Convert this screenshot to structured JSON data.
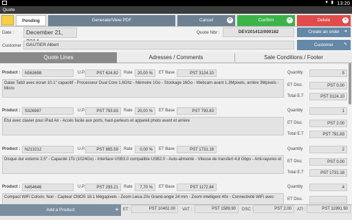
{
  "statusbar": {
    "time": "13:20",
    "signal_icons": "▼ ▮"
  },
  "app": {
    "title": "Quote"
  },
  "header": {
    "status_tab": "Pending",
    "generate_label": "Generate/View PDF",
    "cancel_label": "Cancel",
    "confirm_label": "Confirm",
    "delete_label": "Delete",
    "date_label": "Date :",
    "date_value": "December 21, 2014",
    "quote_nbr_label": "Quote Nbr :",
    "quote_nbr_value": "DEV201412/000182",
    "create_order_label": "Create an order",
    "customer_label": "Customer :",
    "customer_value": "GAUTIER Albert",
    "customer_button": "Customer"
  },
  "tabs": [
    {
      "label": "Quote Lines"
    },
    {
      "label": "Adresses / Comments"
    },
    {
      "label": "Sale Conditions / Footer"
    }
  ],
  "field_labels": {
    "product": "Product :",
    "up": "U.P.",
    "rate": "Rate",
    "et_base": "ET Base",
    "quantity": "Quantity",
    "et_disc": "ET Disc.",
    "total_et": "Total E.T"
  },
  "lines": [
    {
      "product": "N563698",
      "up": "PST 624.82",
      "rate": "20,00 %",
      "et_base": "PST 3124.10",
      "quantity": "5",
      "et_disc": "PST 0.00",
      "total_et": "PST 3124.10",
      "description": "Galax Tab3 avec écran 10.1\" capacitif - Processeur Dual Core 1,6Ghz - Mémoire 1Go - Stockage 16Go - Webcam avant 1,3Mpixels, arrière 3Mpixels - Micro"
    },
    {
      "product": "S326987",
      "up": "PST 793.83",
      "rate": "20,00 %",
      "et_base": "PST 793.83",
      "quantity": "1",
      "et_disc": "PST 2.00",
      "total_et": "PST 791.83",
      "description": "Etui avec clavier pour iPad Air - Accès facile aux ports, haut-parleurs et appareil photo avant et arrière"
    },
    {
      "product": "N213212",
      "up": "PST 865.59",
      "rate": "0,00 %",
      "et_base": "PST 1731.18",
      "quantity": "2",
      "et_disc": "PST 0.00",
      "total_et": "PST 1731.18",
      "description": "Disque dur externe 2.5\" - Capacité 1To (1024Go) - Interface USB3.0 compatible USB2.0 - Auto-alimenté - Vitesse de transfert 4.8 Gbps - Anti-rayures et"
    },
    {
      "product": "N454646",
      "up": "PST 293.21",
      "rate": "7,70 %",
      "et_base": "PST 1172.84",
      "quantity": "4",
      "et_disc": "",
      "total_et": "",
      "description": "Compact WiFi Coloris: Noir - Capteur CMOS 18.1 Mégapixels - Zoom Leica 20x Grand-angle 24 mm - Zoom intelligent 40x - Connectivité WiFi avec"
    }
  ],
  "footer": {
    "add_product": "Add a Product",
    "et_label": "ET :",
    "et_value": "PST 10402.00",
    "vat_label": "VAT :",
    "vat_value": "PST 1589.90",
    "dsc_label": "DSC :",
    "dsc_value": "PST 2.00",
    "ati_label": "ATI :",
    "ati_value": "PST 11991.90"
  },
  "colors": {
    "confirm": "#3bb54a",
    "delete": "#e04c4c",
    "action": "#6d8193",
    "folder": "#f4cf47"
  }
}
